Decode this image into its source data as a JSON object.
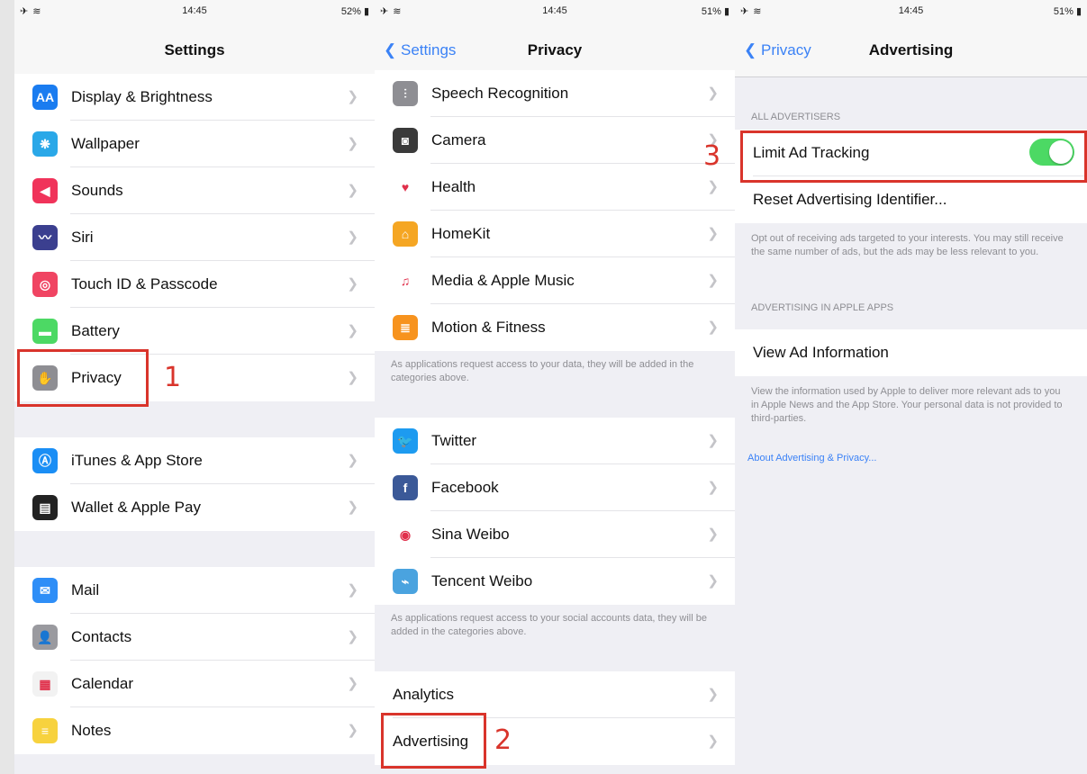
{
  "status": [
    {
      "time": "14:45",
      "battery": "52%"
    },
    {
      "time": "14:45",
      "battery": "51%"
    },
    {
      "time": "14:45",
      "battery": "51%"
    }
  ],
  "colors": {
    "accent": "#3b82f6",
    "highlight": "#d9342b",
    "toggle_on": "#4cd964"
  },
  "panel1": {
    "title": "Settings",
    "group1": [
      {
        "label": "Display & Brightness",
        "icon": "display-brightness-icon",
        "color": "#1a7cf0",
        "glyph": "AA"
      },
      {
        "label": "Wallpaper",
        "icon": "wallpaper-icon",
        "color": "#2aa8e8",
        "glyph": "❋"
      },
      {
        "label": "Sounds",
        "icon": "sounds-icon",
        "color": "#f0335a",
        "glyph": "◀"
      },
      {
        "label": "Siri",
        "icon": "siri-icon",
        "color": "#3b3f8f",
        "glyph": "〰"
      },
      {
        "label": "Touch ID & Passcode",
        "icon": "fingerprint-icon",
        "color": "#f04462",
        "glyph": "◎"
      },
      {
        "label": "Battery",
        "icon": "battery-icon",
        "color": "#4cd964",
        "glyph": "▬"
      },
      {
        "label": "Privacy",
        "icon": "hand-icon",
        "color": "#8e8e93",
        "glyph": "✋"
      }
    ],
    "group2": [
      {
        "label": "iTunes & App Store",
        "icon": "app-store-icon",
        "color": "#1a8ef5",
        "glyph": "Ⓐ"
      },
      {
        "label": "Wallet & Apple Pay",
        "icon": "wallet-icon",
        "color": "#222",
        "glyph": "▤"
      }
    ],
    "group3": [
      {
        "label": "Mail",
        "icon": "mail-icon",
        "color": "#2e8ef7",
        "glyph": "✉"
      },
      {
        "label": "Contacts",
        "icon": "contacts-icon",
        "color": "#9a9a9f",
        "glyph": "👤"
      },
      {
        "label": "Calendar",
        "icon": "calendar-icon",
        "color": "#f2f2f2",
        "glyph": "▦"
      },
      {
        "label": "Notes",
        "icon": "notes-icon",
        "color": "#f7d23e",
        "glyph": "≡"
      }
    ]
  },
  "panel2": {
    "back": "Settings",
    "title": "Privacy",
    "group1": [
      {
        "label": "Speech Recognition",
        "icon": "speech-recognition-icon",
        "color": "#8e8e93",
        "glyph": "⫶"
      },
      {
        "label": "Camera",
        "icon": "camera-icon",
        "color": "#3a3a3a",
        "glyph": "◙"
      },
      {
        "label": "Health",
        "icon": "heart-icon",
        "color": "#ffffff",
        "glyph": "♥"
      },
      {
        "label": "HomeKit",
        "icon": "home-icon",
        "color": "#f5a623",
        "glyph": "⌂"
      },
      {
        "label": "Media & Apple Music",
        "icon": "music-note-icon",
        "color": "#ffffff",
        "glyph": "♫"
      },
      {
        "label": "Motion & Fitness",
        "icon": "motion-fitness-icon",
        "color": "#f7931e",
        "glyph": "≣"
      }
    ],
    "note1": "As applications request access to your data, they will be added in the categories above.",
    "group2": [
      {
        "label": "Twitter",
        "icon": "twitter-icon",
        "color": "#1d9bf0",
        "glyph": "🐦"
      },
      {
        "label": "Facebook",
        "icon": "facebook-icon",
        "color": "#3b5998",
        "glyph": "f"
      },
      {
        "label": "Sina Weibo",
        "icon": "sina-weibo-icon",
        "color": "#ffffff",
        "glyph": "◉"
      },
      {
        "label": "Tencent Weibo",
        "icon": "tencent-weibo-icon",
        "color": "#4aa3df",
        "glyph": "⌁"
      }
    ],
    "note2": "As applications request access to your social accounts data, they will be added in the categories above.",
    "group3": [
      {
        "label": "Analytics"
      },
      {
        "label": "Advertising"
      }
    ]
  },
  "panel3": {
    "back": "Privacy",
    "title": "Advertising",
    "header1": "All Advertisers",
    "limit_label": "Limit Ad Tracking",
    "limit_on": true,
    "reset_label": "Reset Advertising Identifier...",
    "note1": "Opt out of receiving ads targeted to your interests. You may still receive the same number of ads, but the ads may be less relevant to you.",
    "header2": "Advertising in Apple Apps",
    "view_label": "View Ad Information",
    "note2": "View the information used by Apple to deliver more relevant ads to you in Apple News and the App Store. Your personal data is not provided to third-parties.",
    "about_link": "About Advertising & Privacy..."
  },
  "annotations": {
    "step1": "1",
    "step2": "2",
    "step3": "3"
  }
}
